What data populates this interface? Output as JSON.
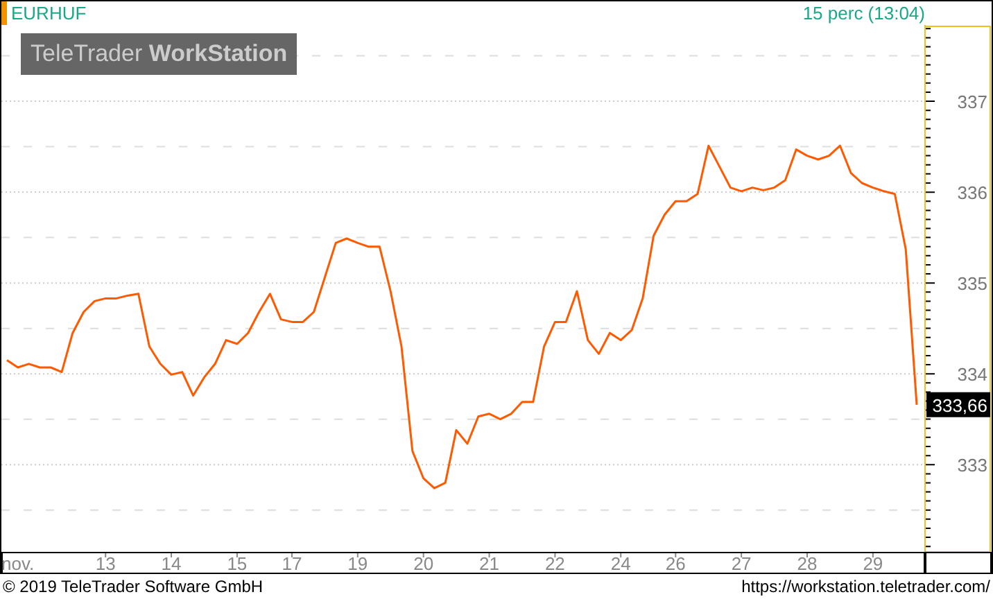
{
  "header": {
    "interval": "15 perc (13:04)"
  },
  "logo": {
    "name": "TeleTrader",
    "product": "WorkStation"
  },
  "chart": {
    "current_price": "333,66",
    "chart_data": {
      "type": "line",
      "categories": [
        null,
        "nov.",
        null,
        null,
        null,
        null,
        null,
        null,
        null,
        "13",
        null,
        null,
        null,
        null,
        null,
        "14",
        null,
        null,
        null,
        null,
        null,
        "15",
        null,
        null,
        null,
        null,
        "17",
        null,
        null,
        null,
        null,
        null,
        "19",
        null,
        null,
        null,
        null,
        null,
        "20",
        null,
        null,
        null,
        null,
        null,
        "21",
        null,
        null,
        null,
        null,
        null,
        "22",
        null,
        null,
        null,
        null,
        null,
        "24",
        null,
        null,
        null,
        null,
        "26",
        null,
        null,
        null,
        null,
        null,
        "27",
        null,
        null,
        null,
        null,
        null,
        "28",
        null,
        null,
        null,
        null,
        null,
        "29",
        null,
        null,
        null,
        null
      ],
      "series": [
        {
          "name": "EURHUF",
          "color": "#ff5a00",
          "values": [
            334.15,
            334.07,
            334.11,
            334.07,
            334.07,
            334.02,
            334.45,
            334.68,
            334.8,
            334.83,
            334.83,
            334.86,
            334.88,
            334.3,
            334.11,
            333.99,
            334.02,
            333.76,
            333.96,
            334.11,
            334.37,
            334.33,
            334.45,
            334.68,
            334.88,
            334.6,
            334.57,
            334.57,
            334.68,
            335.06,
            335.44,
            335.49,
            335.44,
            335.4,
            335.4,
            334.91,
            334.3,
            333.15,
            332.85,
            332.74,
            332.8,
            333.38,
            333.23,
            333.53,
            333.56,
            333.5,
            333.56,
            333.69,
            333.69,
            334.3,
            334.57,
            334.57,
            334.91,
            334.37,
            334.22,
            334.45,
            334.37,
            334.48,
            334.83,
            335.52,
            335.75,
            335.9,
            335.9,
            335.98,
            336.51,
            336.28,
            336.05,
            336.01,
            336.05,
            336.02,
            336.05,
            336.13,
            336.47,
            336.4,
            336.36,
            336.4,
            336.51,
            336.21,
            336.1,
            336.05,
            336.01,
            335.98,
            335.37,
            333.66
          ]
        }
      ],
      "ylim": [
        332.04,
        337.84
      ],
      "grid": true,
      "yticks": [
        333,
        334,
        335,
        336,
        337
      ]
    }
  },
  "footer": {
    "copyright": "© 2019 TeleTrader Software GmbH",
    "url": "https://workstation.teletrader.com/"
  }
}
